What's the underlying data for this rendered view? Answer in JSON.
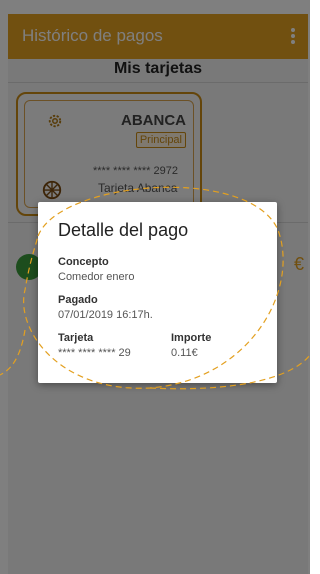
{
  "appbar": {
    "title": "Histórico de pagos",
    "overflow_icon": "more-vert-icon"
  },
  "section": {
    "title": "Mis tarjetas"
  },
  "card": {
    "bank": "ABANCA",
    "badge": "Principal",
    "number": "**** **** **** 2972",
    "holder": "Tarjeta Abanca",
    "settings_icon": "gear-icon",
    "brand_icon": "wheel-icon"
  },
  "payment_item": {
    "amount": "€",
    "status_icon": "check-icon"
  },
  "dialog": {
    "title": "Detalle del pago",
    "concept_label": "Concepto",
    "concept_value": "Comedor enero",
    "paid_label": "Pagado",
    "paid_value": "07/01/2019 16:17h.",
    "card_label": "Tarjeta",
    "card_value": "**** **** **** 29",
    "amount_label": "Importe",
    "amount_value": "0.11€"
  },
  "colors": {
    "accent": "#e3a020",
    "card_border": "#c98a15",
    "success": "#3a9a3a"
  }
}
